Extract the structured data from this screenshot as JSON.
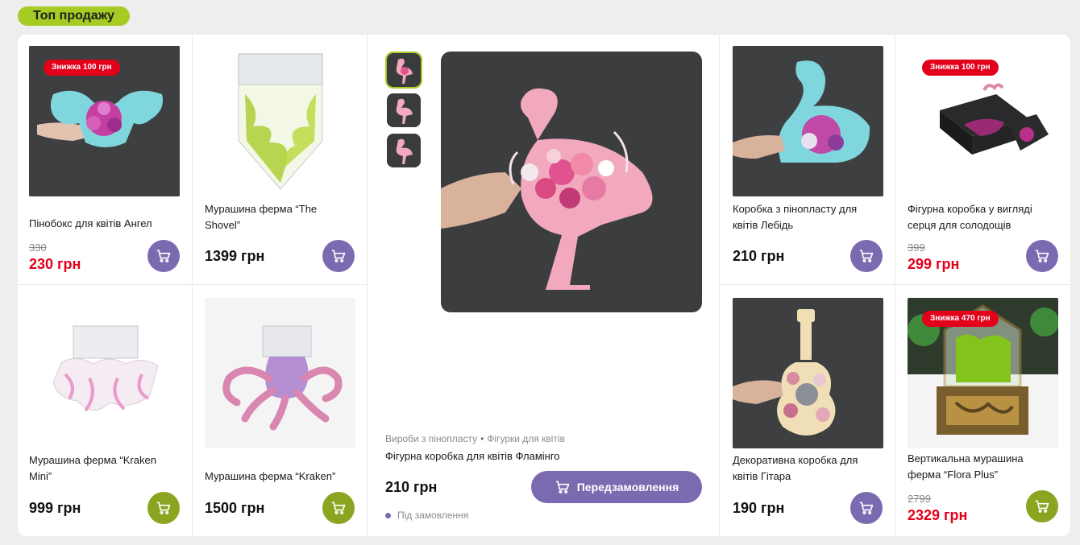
{
  "section_title": "Топ продажу",
  "currency": "грн",
  "colors": {
    "accent_green": "#a6cb22",
    "cart_purple": "#7b6ab0",
    "cart_green": "#8aa51f",
    "sale_red": "#e3001b"
  },
  "products": [
    {
      "name": "Пінобокс для квітів Ангел",
      "badge": "Знижка 100 грн",
      "old_price": "330",
      "price": "230 грн",
      "cart_icon": "cart-icon"
    },
    {
      "name": "Мурашина ферма “The Shovel”",
      "price": "1399 грн",
      "cart_icon": "cart-icon"
    },
    {
      "name": "Коробка з пінопласту для квітів Лебідь",
      "price": "210 грн",
      "cart_icon": "cart-icon"
    },
    {
      "name": "Фігурна коробка у вигляді серця для солодощів",
      "badge": "Знижка 100 грн",
      "old_price": "399",
      "price": "299 грн",
      "cart_icon": "cart-icon"
    },
    {
      "name": "Мурашина ферма “Kraken Mini”",
      "price": "999 грн",
      "cart_icon": "cart-icon"
    },
    {
      "name": "Мурашина ферма “Kraken”",
      "price": "1500 грн",
      "cart_icon": "cart-icon"
    },
    {
      "name": "Декоративна коробка для квітів Гітара",
      "price": "190 грн",
      "cart_icon": "cart-icon"
    },
    {
      "name": "Вертикальна мурашина ферма “Flora Plus”",
      "badge": "Знижка 470 грн",
      "old_price": "2799",
      "price": "2329 грн",
      "cart_icon": "cart-icon"
    }
  ],
  "featured": {
    "categories": [
      "Вироби з пінопласту",
      "Фігурки для квітів"
    ],
    "name": "Фігурна коробка для квітів Фламінго",
    "price": "210 грн",
    "preorder_label": "Передзамовлення",
    "status": "Під замовлення",
    "thumbnails": 3
  }
}
